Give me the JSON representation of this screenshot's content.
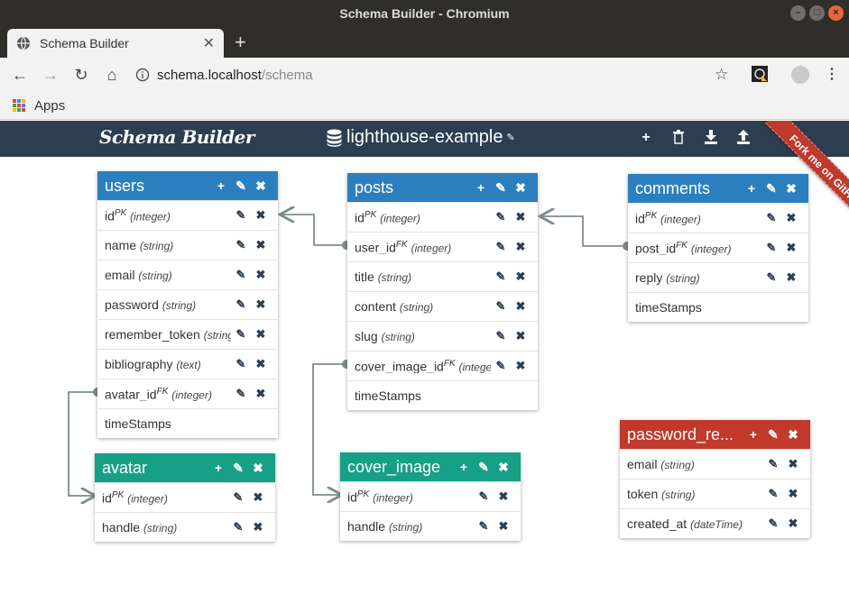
{
  "window": {
    "title": "Schema Builder - Chromium"
  },
  "tab": {
    "title": "Schema Builder"
  },
  "address": {
    "host": "schema.localhost",
    "path": "/schema"
  },
  "bookmarks": {
    "apps_label": "Apps"
  },
  "app": {
    "brand": "Schema Builder",
    "database": "lighthouse-example",
    "ribbon": "Fork me on GitHub"
  },
  "icons": {
    "add": "+",
    "edit": "✎",
    "delete": "✖",
    "trash": "trash-icon",
    "download": "download-icon",
    "upload": "upload-icon"
  },
  "tables": {
    "users": {
      "name": "users",
      "fields": [
        {
          "name": "id",
          "key": "PK",
          "type": "(integer)"
        },
        {
          "name": "name",
          "key": "",
          "type": "(string)"
        },
        {
          "name": "email",
          "key": "",
          "type": "(string)"
        },
        {
          "name": "password",
          "key": "",
          "type": "(string)"
        },
        {
          "name": "remember_token",
          "key": "",
          "type": "(string)"
        },
        {
          "name": "bibliography",
          "key": "",
          "type": "(text)"
        },
        {
          "name": "avatar_id",
          "key": "FK",
          "type": "(integer)"
        }
      ],
      "timestamps": "timeStamps"
    },
    "posts": {
      "name": "posts",
      "fields": [
        {
          "name": "id",
          "key": "PK",
          "type": "(integer)"
        },
        {
          "name": "user_id",
          "key": "FK",
          "type": "(integer)"
        },
        {
          "name": "title",
          "key": "",
          "type": "(string)"
        },
        {
          "name": "content",
          "key": "",
          "type": "(string)"
        },
        {
          "name": "slug",
          "key": "",
          "type": "(string)"
        },
        {
          "name": "cover_image_id",
          "key": "FK",
          "type": "(integer)"
        }
      ],
      "timestamps": "timeStamps"
    },
    "comments": {
      "name": "comments",
      "fields": [
        {
          "name": "id",
          "key": "PK",
          "type": "(integer)"
        },
        {
          "name": "post_id",
          "key": "FK",
          "type": "(integer)"
        },
        {
          "name": "reply",
          "key": "",
          "type": "(string)"
        }
      ],
      "timestamps": "timeStamps"
    },
    "avatar": {
      "name": "avatar",
      "fields": [
        {
          "name": "id",
          "key": "PK",
          "type": "(integer)"
        },
        {
          "name": "handle",
          "key": "",
          "type": "(string)"
        }
      ]
    },
    "cover_image": {
      "name": "cover_image",
      "fields": [
        {
          "name": "id",
          "key": "PK",
          "type": "(integer)"
        },
        {
          "name": "handle",
          "key": "",
          "type": "(string)"
        }
      ]
    },
    "password_resets": {
      "name": "password_re...",
      "fields": [
        {
          "name": "email",
          "key": "",
          "type": "(string)"
        },
        {
          "name": "token",
          "key": "",
          "type": "(string)"
        },
        {
          "name": "created_at",
          "key": "",
          "type": "(dateTime)"
        }
      ]
    }
  },
  "colors": {
    "appbar": "#2c3e50",
    "table_blue": "#2c7fbf",
    "table_green": "#16a085",
    "table_red": "#c0392b",
    "link": "#7f8c8d"
  }
}
